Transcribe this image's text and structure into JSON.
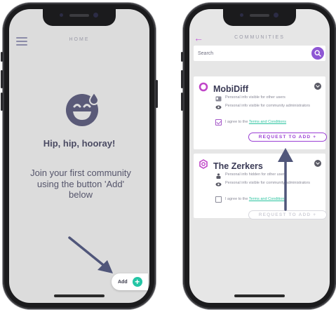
{
  "left_screen": {
    "header_title": "HOME",
    "headline": "Hip, hip, hooray!",
    "message": "Join your first community using the button 'Add' below",
    "add_button": {
      "label": "Add",
      "icon": "+"
    }
  },
  "right_screen": {
    "header_title": "COMMUNITIES",
    "search": {
      "placeholder": "Search"
    },
    "communities": [
      {
        "name": "MobiDiff",
        "rows": [
          "Personal info visible for other users",
          "Personal info visible for community administrators"
        ],
        "agree_prefix": "I agree to the",
        "agree_link": "Terms and Conditions",
        "agreed": true,
        "request_label": "REQUEST TO ADD +"
      },
      {
        "name": "The Zerkers",
        "rows": [
          "Personal info hidden for other users",
          "Personal info visible for community administrators"
        ],
        "agree_prefix": "I agree to the",
        "agree_link": "Terms and Conditions",
        "agreed": false,
        "request_label": "REQUEST TO ADD +"
      }
    ]
  },
  "colors": {
    "accent_purple": "#9b3fd4",
    "accent_teal": "#24c5a5",
    "text_dark": "#4a4a62",
    "annotation_arrow": "#50567a"
  }
}
